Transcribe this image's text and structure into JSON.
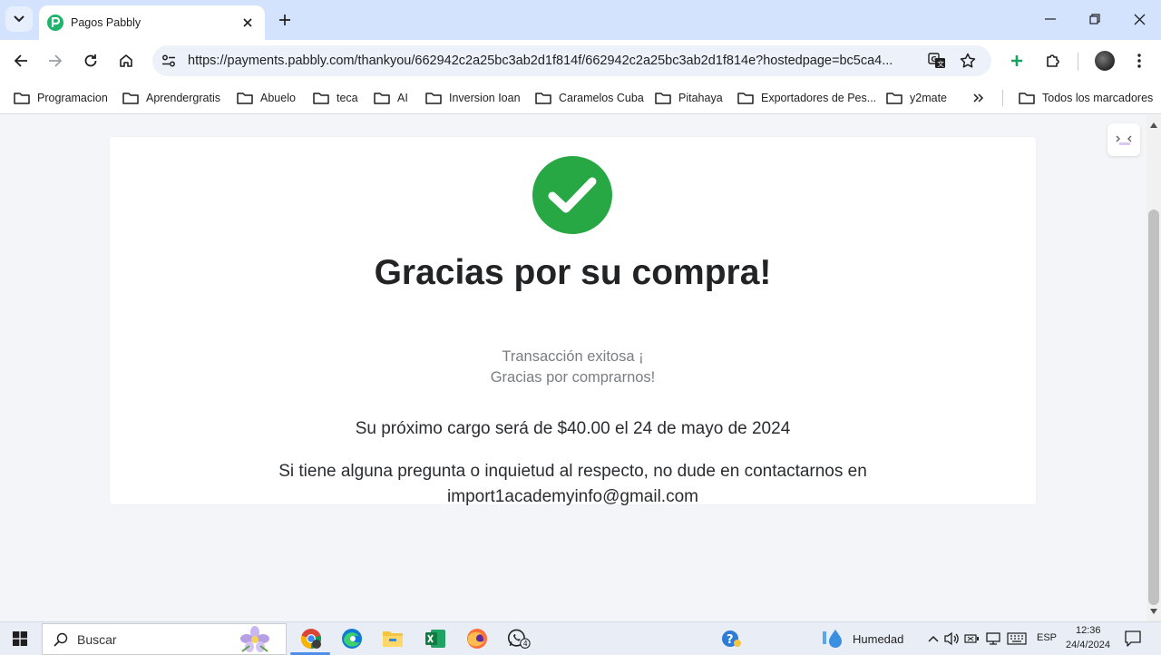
{
  "browser": {
    "tab_title": "Pagos Pabbly",
    "url": "https://payments.pabbly.com/thankyou/662942c2a25bc3ab2d1f814f/662942c2a25bc3ab2d1f814e?hostedpage=bc5ca4...",
    "bookmarks": [
      "Programacion",
      "Aprendergratis",
      "Abuelo",
      "teca",
      "AI",
      "Inversion Ioan",
      "Caramelos Cuba",
      "Pitahaya",
      "Exportadores de Pes...",
      "y2mate"
    ],
    "all_bookmarks": "Todos los marcadores"
  },
  "page": {
    "heading": "Gracias por su compra!",
    "subtitle_line1": "Transacción exitosa ¡",
    "subtitle_line2": "Gracias por comprarnos!",
    "next_charge": "Su próximo cargo será de $40.00 el 24 de mayo de 2024",
    "contact_line1": "Si tiene alguna pregunta o inquietud al respecto, no dude en contactarnos en",
    "contact_email": "import1academyinfo@gmail.com",
    "accent_color": "#28a745"
  },
  "taskbar": {
    "search_label": "Buscar",
    "whatsapp_badge": "4",
    "weather": "Humedad",
    "language": "ESP",
    "time": "12:36",
    "date": "24/4/2024"
  }
}
